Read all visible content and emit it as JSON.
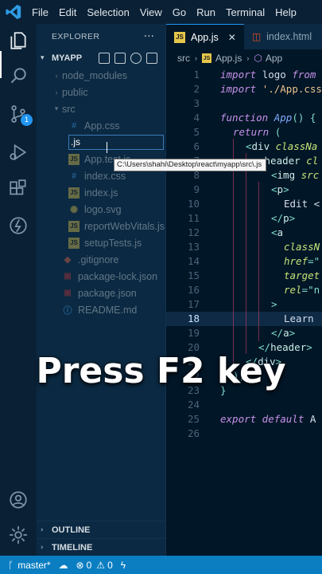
{
  "titlebar": {
    "menu": [
      "File",
      "Edit",
      "Selection",
      "View",
      "Go",
      "Run",
      "Terminal",
      "Help"
    ]
  },
  "activity": {
    "icons": [
      "explorer-icon",
      "search-icon",
      "source-control-icon",
      "run-debug-icon",
      "extensions-icon",
      "remote-icon",
      "account-icon",
      "settings-icon"
    ],
    "source_control_badge": "1"
  },
  "sidebar": {
    "title": "EXPLORER",
    "more": "···",
    "project": "MYAPP",
    "tree": [
      {
        "label": "node_modules",
        "icon": "folder",
        "depth": 1
      },
      {
        "label": "public",
        "icon": "folder",
        "depth": 1
      },
      {
        "label": "src",
        "icon": "folder",
        "depth": 1
      },
      {
        "label": "App.css",
        "icon": "css",
        "depth": 2
      },
      {
        "label": "",
        "icon": "js",
        "depth": 2
      },
      {
        "label": "App.test.js",
        "icon": "js",
        "depth": 2
      },
      {
        "label": "index.css",
        "icon": "css",
        "depth": 2
      },
      {
        "label": "index.js",
        "icon": "js",
        "depth": 2
      },
      {
        "label": "logo.svg",
        "icon": "sun",
        "depth": 2
      },
      {
        "label": "reportWebVitals.js",
        "icon": "js",
        "depth": 2
      },
      {
        "label": "setupTests.js",
        "icon": "js",
        "depth": 2
      },
      {
        "label": ".gitignore",
        "icon": "git",
        "depth": 1
      },
      {
        "label": "package-lock.json",
        "icon": "npm",
        "depth": 1
      },
      {
        "label": "package.json",
        "icon": "npm",
        "depth": 1
      },
      {
        "label": "README.md",
        "icon": "info",
        "depth": 1
      }
    ],
    "rename_value": ".js",
    "tooltip": "C:\\Users\\shahi\\Desktop\\react\\myapp\\src\\.js",
    "outline": "OUTLINE",
    "timeline": "TIMELINE"
  },
  "editor": {
    "tabs": [
      {
        "label": "App.js",
        "icon": "js",
        "active": true,
        "close": "✕"
      },
      {
        "label": "index.html",
        "icon": "html",
        "active": false
      }
    ],
    "breadcrumb": [
      "src",
      "App.js",
      "App"
    ],
    "current_line": 18,
    "lines": [
      {
        "n": "1",
        "indent": 0,
        "tokens": [
          [
            "kw",
            "import "
          ],
          [
            "plain",
            "logo "
          ],
          [
            "kw",
            "from"
          ]
        ]
      },
      {
        "n": "2",
        "indent": 0,
        "tokens": [
          [
            "kw",
            "import "
          ],
          [
            "str",
            "'./App.css"
          ]
        ]
      },
      {
        "n": "3",
        "indent": 0,
        "tokens": []
      },
      {
        "n": "4",
        "indent": 0,
        "tokens": [
          [
            "kw",
            "function "
          ],
          [
            "fn",
            "App"
          ],
          [
            "punc",
            "() {"
          ]
        ]
      },
      {
        "n": "5",
        "indent": 1,
        "tokens": [
          [
            "kw",
            "return "
          ],
          [
            "punc",
            "("
          ]
        ]
      },
      {
        "n": "6",
        "indent": 2,
        "tokens": [
          [
            "punc",
            "<"
          ],
          [
            "tag",
            "div "
          ],
          [
            "attr",
            "classNa"
          ]
        ]
      },
      {
        "n": "7",
        "indent": 3,
        "tokens": [
          [
            "punc",
            "<"
          ],
          [
            "tag",
            "header "
          ],
          [
            "attr",
            "cl"
          ]
        ]
      },
      {
        "n": "8",
        "indent": 4,
        "tokens": [
          [
            "punc",
            "<"
          ],
          [
            "tag",
            "img "
          ],
          [
            "attr",
            "src"
          ]
        ]
      },
      {
        "n": "9",
        "indent": 4,
        "tokens": [
          [
            "punc",
            "<"
          ],
          [
            "tag",
            "p"
          ],
          [
            "punc",
            ">"
          ]
        ]
      },
      {
        "n": "10",
        "indent": 5,
        "tokens": [
          [
            "plain",
            "Edit <"
          ]
        ]
      },
      {
        "n": "11",
        "indent": 4,
        "tokens": [
          [
            "punc",
            "</"
          ],
          [
            "tag",
            "p"
          ],
          [
            "punc",
            ">"
          ]
        ]
      },
      {
        "n": "12",
        "indent": 4,
        "tokens": [
          [
            "punc",
            "<"
          ],
          [
            "tag",
            "a"
          ]
        ]
      },
      {
        "n": "13",
        "indent": 5,
        "tokens": [
          [
            "attr",
            "classN"
          ]
        ]
      },
      {
        "n": "14",
        "indent": 5,
        "tokens": [
          [
            "attr",
            "href"
          ],
          [
            "punc",
            "=\""
          ]
        ]
      },
      {
        "n": "15",
        "indent": 5,
        "tokens": [
          [
            "attr",
            "target"
          ]
        ]
      },
      {
        "n": "16",
        "indent": 5,
        "tokens": [
          [
            "attr",
            "rel"
          ],
          [
            "punc",
            "=\"n"
          ]
        ]
      },
      {
        "n": "17",
        "indent": 4,
        "tokens": [
          [
            "punc",
            ">"
          ]
        ]
      },
      {
        "n": "18",
        "indent": 5,
        "tokens": [
          [
            "plain",
            "Learn "
          ]
        ]
      },
      {
        "n": "19",
        "indent": 4,
        "tokens": [
          [
            "punc",
            "</"
          ],
          [
            "tag",
            "a"
          ],
          [
            "punc",
            ">"
          ]
        ]
      },
      {
        "n": "20",
        "indent": 3,
        "tokens": [
          [
            "punc",
            "</"
          ],
          [
            "tag",
            "header"
          ],
          [
            "punc",
            ">"
          ]
        ]
      },
      {
        "n": "21",
        "indent": 2,
        "tokens": [
          [
            "punc",
            "</"
          ],
          [
            "tag",
            "div"
          ],
          [
            "punc",
            ">"
          ]
        ]
      },
      {
        "n": "22",
        "indent": 1,
        "tokens": [
          [
            "punc",
            ");"
          ]
        ]
      },
      {
        "n": "23",
        "indent": 0,
        "tokens": [
          [
            "punc",
            "}"
          ]
        ]
      },
      {
        "n": "24",
        "indent": 0,
        "tokens": []
      },
      {
        "n": "25",
        "indent": 0,
        "tokens": [
          [
            "kw",
            "export default "
          ],
          [
            "plain",
            "A"
          ]
        ]
      },
      {
        "n": "26",
        "indent": 0,
        "tokens": []
      }
    ]
  },
  "caption": "Press F2 key",
  "statusbar": {
    "branch": "master*",
    "errors": "0",
    "warnings": "0"
  },
  "colors": {
    "accent": "#2196f3",
    "statusbar": "#0b7ec2",
    "editor_bg": "#011627",
    "sidebar_bg": "#0b2942"
  }
}
